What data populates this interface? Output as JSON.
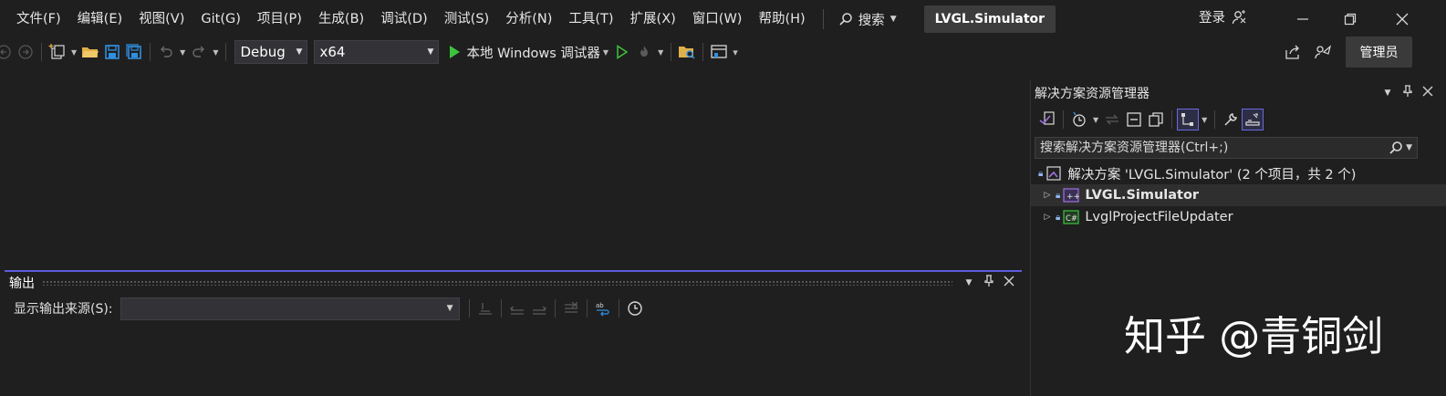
{
  "menu": {
    "items": [
      "文件(F)",
      "编辑(E)",
      "视图(V)",
      "Git(G)",
      "项目(P)",
      "生成(B)",
      "调试(D)",
      "测试(S)",
      "分析(N)",
      "工具(T)",
      "扩展(X)",
      "窗口(W)",
      "帮助(H)"
    ],
    "search_label": "搜索",
    "project_name": "LVGL.Simulator",
    "login_label": "登录"
  },
  "toolbar": {
    "config": "Debug",
    "platform": "x64",
    "run_label": "本地 Windows 调试器",
    "admin_label": "管理员"
  },
  "output_panel": {
    "title": "输出",
    "source_label": "显示输出来源(S):"
  },
  "solution_explorer": {
    "title": "解决方案资源管理器",
    "search_placeholder": "搜索解决方案资源管理器(Ctrl+;)",
    "solution_label": "解决方案 'LVGL.Simulator' (2 个项目，共 2 个)",
    "projects": [
      "LVGL.Simulator",
      "LvglProjectFileUpdater"
    ]
  },
  "watermark": "知乎 @青铜剑",
  "colors": {
    "background": "#1f1f1f",
    "accent": "#5c5cdb",
    "run_green": "#3cc43c",
    "save_blue": "#2f8fe0",
    "folder_yellow": "#e0b04a"
  }
}
